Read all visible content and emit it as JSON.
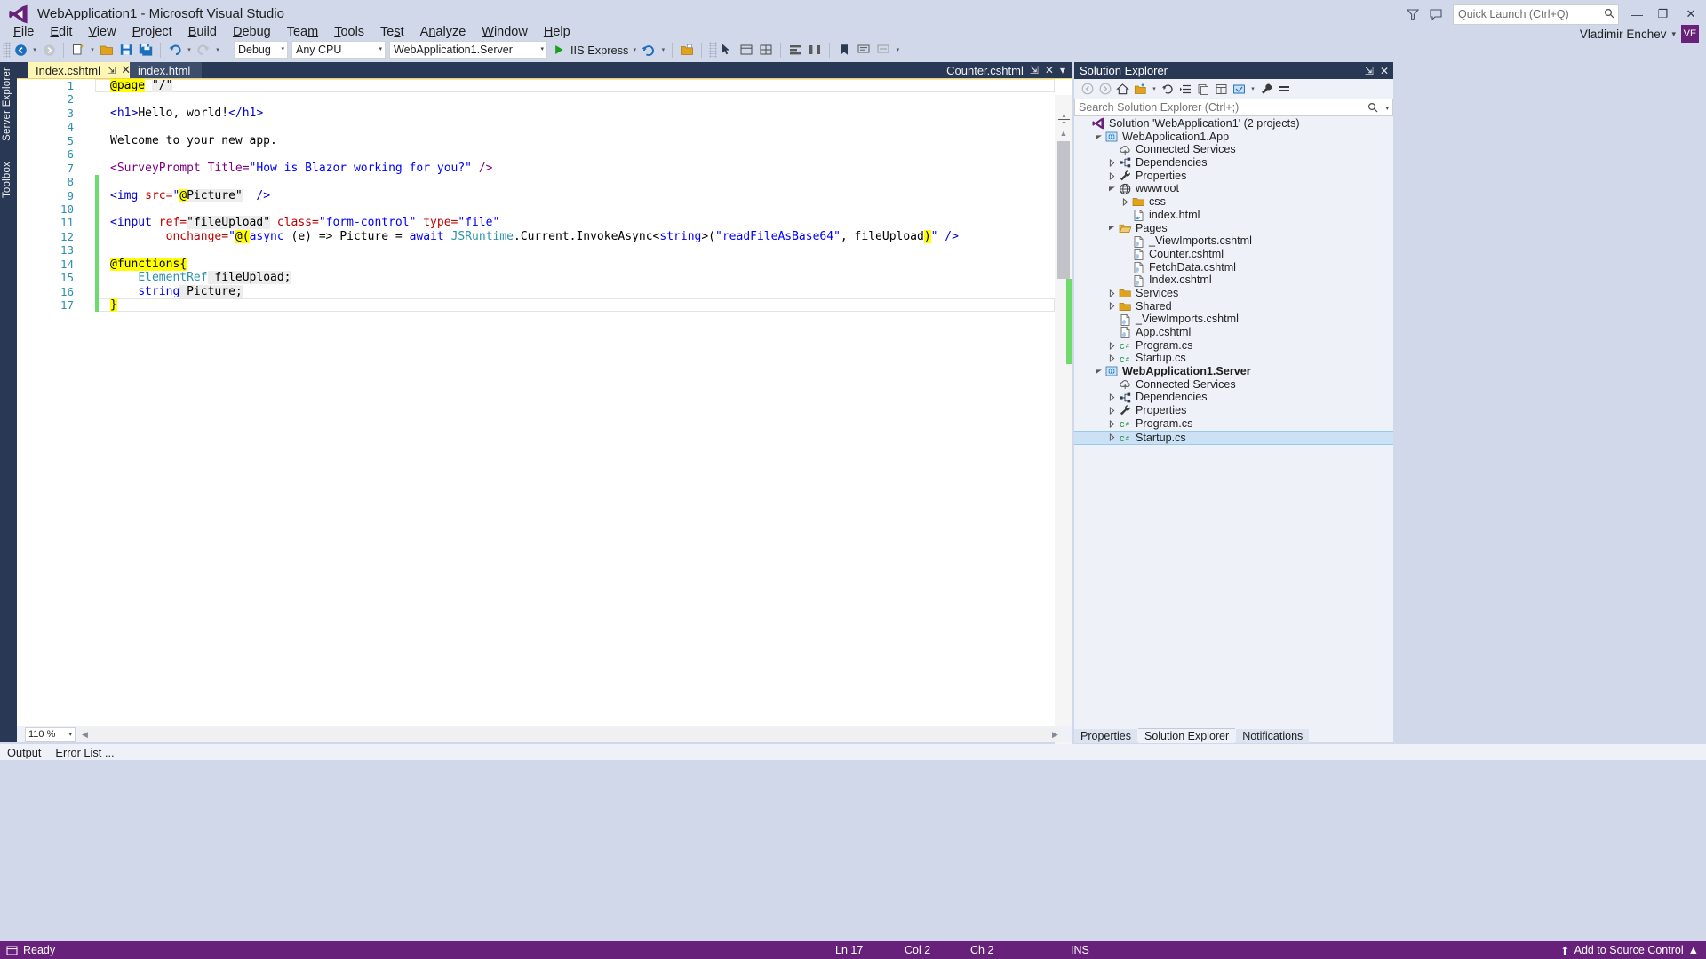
{
  "window": {
    "title": "WebApplication1 - Microsoft Visual Studio",
    "minimize_label": "—",
    "maximize_label": "❐",
    "close_label": "✕"
  },
  "quick_launch": {
    "placeholder": "Quick Launch (Ctrl+Q)"
  },
  "account": {
    "name": "Vladimir Enchev",
    "initials": "VE",
    "caret": "▾"
  },
  "menu": {
    "items": [
      {
        "label": "File",
        "accel": "F"
      },
      {
        "label": "Edit",
        "accel": "E"
      },
      {
        "label": "View",
        "accel": "V"
      },
      {
        "label": "Project",
        "accel": "P"
      },
      {
        "label": "Build",
        "accel": "B"
      },
      {
        "label": "Debug",
        "accel": "D"
      },
      {
        "label": "Team",
        "accel": "m"
      },
      {
        "label": "Tools",
        "accel": "T"
      },
      {
        "label": "Test",
        "accel": "s"
      },
      {
        "label": "Analyze",
        "accel": "n"
      },
      {
        "label": "Window",
        "accel": "W"
      },
      {
        "label": "Help",
        "accel": "H"
      }
    ]
  },
  "toolbar": {
    "configuration": "Debug",
    "platform": "Any CPU",
    "startup_project": "WebApplication1.Server",
    "run_label": "IIS Express",
    "caret": "▾"
  },
  "left_dock": {
    "tabs": [
      "Server Explorer",
      "Toolbox"
    ]
  },
  "editor": {
    "tabs": [
      {
        "label": "Index.cshtml",
        "active": true,
        "pin": "⇲",
        "close": "✕"
      },
      {
        "label": "index.html",
        "active": false
      }
    ],
    "right_caption": "Counter.cshtml",
    "right_pin": "⇲",
    "right_close": "✕",
    "right_menu": "▾",
    "zoom": "110 %",
    "zoom_caret": "▾",
    "lines": [
      {
        "n": "1",
        "change": "",
        "tokens": [
          {
            "t": "@page",
            "c": "k-razor-hl"
          },
          {
            "t": " ",
            "c": "k-plain"
          },
          {
            "t": "\"/\"",
            "c": "k-field"
          }
        ]
      },
      {
        "n": "2",
        "change": "",
        "tokens": []
      },
      {
        "n": "3",
        "change": "",
        "tokens": [
          {
            "t": "<h1>",
            "c": "k-tag"
          },
          {
            "t": "Hello, world!",
            "c": "k-plain"
          },
          {
            "t": "</h1>",
            "c": "k-tag"
          }
        ]
      },
      {
        "n": "4",
        "change": "",
        "tokens": []
      },
      {
        "n": "5",
        "change": "",
        "tokens": [
          {
            "t": "Welcome to your new app.",
            "c": "k-plain"
          }
        ]
      },
      {
        "n": "6",
        "change": "",
        "tokens": []
      },
      {
        "n": "7",
        "change": "",
        "tokens": [
          {
            "t": "<SurveyPrompt ",
            "c": "k-elem"
          },
          {
            "t": "Title=",
            "c": "k-elem"
          },
          {
            "t": "\"How is Blazor working for you?\"",
            "c": "k-str"
          },
          {
            "t": " />",
            "c": "k-elem"
          }
        ]
      },
      {
        "n": "8",
        "change": "green",
        "tokens": []
      },
      {
        "n": "9",
        "change": "green",
        "tokens": [
          {
            "t": "<img ",
            "c": "k-tag"
          },
          {
            "t": "src=",
            "c": "k-attr"
          },
          {
            "t": "\"",
            "c": "k-str"
          },
          {
            "t": "@",
            "c": "k-razor-hl"
          },
          {
            "t": "Picture\"",
            "c": "k-field"
          },
          {
            "t": "  />",
            "c": "k-tag"
          }
        ]
      },
      {
        "n": "10",
        "change": "green",
        "tokens": []
      },
      {
        "n": "11",
        "change": "green",
        "tokens": [
          {
            "t": "<input ",
            "c": "k-tag"
          },
          {
            "t": "ref=",
            "c": "k-attr"
          },
          {
            "t": "\"fileUpload\"",
            "c": "k-field"
          },
          {
            "t": " ",
            "c": "k-plain"
          },
          {
            "t": "class=",
            "c": "k-attr"
          },
          {
            "t": "\"form-control\"",
            "c": "k-str"
          },
          {
            "t": " ",
            "c": "k-plain"
          },
          {
            "t": "type=",
            "c": "k-attr"
          },
          {
            "t": "\"file\"",
            "c": "k-str"
          }
        ]
      },
      {
        "n": "12",
        "change": "green",
        "tokens": [
          {
            "t": "        ",
            "c": "k-plain"
          },
          {
            "t": "onchange=",
            "c": "k-attr"
          },
          {
            "t": "\"",
            "c": "k-str"
          },
          {
            "t": "@(",
            "c": "k-razor-hl"
          },
          {
            "t": "async",
            "c": "k-kw"
          },
          {
            "t": " (e) => Picture = ",
            "c": "k-plain"
          },
          {
            "t": "await",
            "c": "k-kw"
          },
          {
            "t": " ",
            "c": "k-plain"
          },
          {
            "t": "JSRuntime",
            "c": "k-type"
          },
          {
            "t": ".Current.InvokeAsync<",
            "c": "k-plain"
          },
          {
            "t": "string",
            "c": "k-kw"
          },
          {
            "t": ">(",
            "c": "k-plain"
          },
          {
            "t": "\"readFileAsBase64\"",
            "c": "k-str"
          },
          {
            "t": ", fileUpload",
            "c": "k-plain"
          },
          {
            "t": ")",
            "c": "k-razor-hl"
          },
          {
            "t": "\"",
            "c": "k-str"
          },
          {
            "t": " />",
            "c": "k-tag"
          }
        ]
      },
      {
        "n": "13",
        "change": "green",
        "tokens": []
      },
      {
        "n": "14",
        "change": "green",
        "tokens": [
          {
            "t": "@functions{",
            "c": "k-razor-hl"
          }
        ]
      },
      {
        "n": "15",
        "change": "green",
        "tokens": [
          {
            "t": "    ",
            "c": "k-plain"
          },
          {
            "t": "ElementRef",
            "c": "k-type"
          },
          {
            "t": " fileUpload;",
            "c": "k-field"
          }
        ]
      },
      {
        "n": "16",
        "change": "green",
        "tokens": [
          {
            "t": "    ",
            "c": "k-plain"
          },
          {
            "t": "string",
            "c": "k-kw"
          },
          {
            "t": " Picture;",
            "c": "k-field"
          }
        ]
      },
      {
        "n": "17",
        "change": "green",
        "tokens": [
          {
            "t": "}",
            "c": "k-razor-hl"
          }
        ]
      }
    ]
  },
  "solution_explorer": {
    "title": "Solution Explorer",
    "search_placeholder": "Search Solution Explorer (Ctrl+;)",
    "tabs": [
      {
        "label": "Properties",
        "active": false
      },
      {
        "label": "Solution Explorer",
        "active": true
      },
      {
        "label": "Notifications",
        "active": false
      }
    ],
    "tree": [
      {
        "label": "Solution 'WebApplication1' (2 projects)",
        "indent": 0,
        "expander": "",
        "icon": "solution",
        "bold": false,
        "selected": false
      },
      {
        "label": "WebApplication1.App",
        "indent": 1,
        "expander": "open",
        "icon": "project-web",
        "bold": false,
        "selected": false
      },
      {
        "label": "Connected Services",
        "indent": 2,
        "expander": "",
        "icon": "cloud",
        "bold": false,
        "selected": false
      },
      {
        "label": "Dependencies",
        "indent": 2,
        "expander": "closed",
        "icon": "deps",
        "bold": false,
        "selected": false
      },
      {
        "label": "Properties",
        "indent": 2,
        "expander": "closed",
        "icon": "wrench",
        "bold": false,
        "selected": false
      },
      {
        "label": "wwwroot",
        "indent": 2,
        "expander": "open",
        "icon": "globe",
        "bold": false,
        "selected": false
      },
      {
        "label": "css",
        "indent": 3,
        "expander": "closed",
        "icon": "folder",
        "bold": false,
        "selected": false
      },
      {
        "label": "index.html",
        "indent": 3,
        "expander": "",
        "icon": "html",
        "bold": false,
        "selected": false
      },
      {
        "label": "Pages",
        "indent": 2,
        "expander": "open",
        "icon": "folder-open",
        "bold": false,
        "selected": false
      },
      {
        "label": "_ViewImports.cshtml",
        "indent": 3,
        "expander": "",
        "icon": "cshtml",
        "bold": false,
        "selected": false
      },
      {
        "label": "Counter.cshtml",
        "indent": 3,
        "expander": "",
        "icon": "cshtml",
        "bold": false,
        "selected": false
      },
      {
        "label": "FetchData.cshtml",
        "indent": 3,
        "expander": "",
        "icon": "cshtml",
        "bold": false,
        "selected": false
      },
      {
        "label": "Index.cshtml",
        "indent": 3,
        "expander": "",
        "icon": "cshtml",
        "bold": false,
        "selected": false
      },
      {
        "label": "Services",
        "indent": 2,
        "expander": "closed",
        "icon": "folder",
        "bold": false,
        "selected": false
      },
      {
        "label": "Shared",
        "indent": 2,
        "expander": "closed",
        "icon": "folder",
        "bold": false,
        "selected": false
      },
      {
        "label": "_ViewImports.cshtml",
        "indent": 2,
        "expander": "",
        "icon": "cshtml",
        "bold": false,
        "selected": false
      },
      {
        "label": "App.cshtml",
        "indent": 2,
        "expander": "",
        "icon": "cshtml",
        "bold": false,
        "selected": false
      },
      {
        "label": "Program.cs",
        "indent": 2,
        "expander": "closed",
        "icon": "cs",
        "bold": false,
        "selected": false
      },
      {
        "label": "Startup.cs",
        "indent": 2,
        "expander": "closed",
        "icon": "cs",
        "bold": false,
        "selected": false
      },
      {
        "label": "WebApplication1.Server",
        "indent": 1,
        "expander": "open",
        "icon": "project-web",
        "bold": true,
        "selected": false
      },
      {
        "label": "Connected Services",
        "indent": 2,
        "expander": "",
        "icon": "cloud",
        "bold": false,
        "selected": false
      },
      {
        "label": "Dependencies",
        "indent": 2,
        "expander": "closed",
        "icon": "deps",
        "bold": false,
        "selected": false
      },
      {
        "label": "Properties",
        "indent": 2,
        "expander": "closed",
        "icon": "wrench",
        "bold": false,
        "selected": false
      },
      {
        "label": "Program.cs",
        "indent": 2,
        "expander": "closed",
        "icon": "cs",
        "bold": false,
        "selected": false
      },
      {
        "label": "Startup.cs",
        "indent": 2,
        "expander": "closed",
        "icon": "cs",
        "bold": false,
        "selected": true
      }
    ]
  },
  "bottom_dock": {
    "tabs": [
      "Output",
      "Error List ..."
    ]
  },
  "status_bar": {
    "ready": "Ready",
    "line": "Ln 17",
    "col": "Col 2",
    "ch": "Ch 2",
    "ins": "INS",
    "source_control": "Add to Source Control",
    "source_caret": "▲",
    "source_up": "⬆"
  },
  "colors": {
    "accent_purple": "#68217a",
    "chrome": "#d0d8ea",
    "dock": "#293955",
    "tab_active": "#fdf6b4",
    "selection": "#cbe1f5",
    "change_green": "#6ddc6d"
  }
}
